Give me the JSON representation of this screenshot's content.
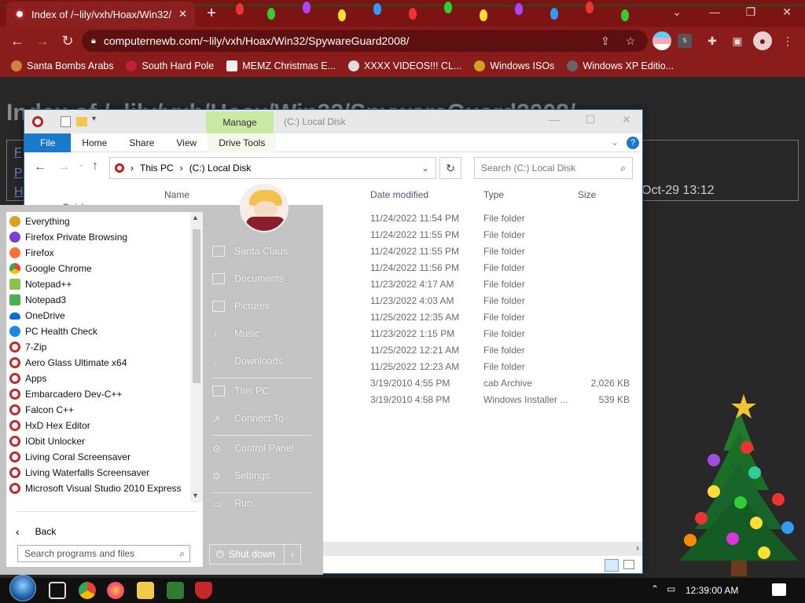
{
  "browser": {
    "tab_title": "Index of /~lily/vxh/Hoax/Win32/",
    "url": "computernewb.com/~lily/vxh/Hoax/Win32/SpywareGuard2008/",
    "bookmarks": [
      "Santa Bombs Arabs",
      "South Hard Pole",
      "MEMZ Christmas E...",
      "XXXX VIDEOS!!! CL...",
      "Windows ISOs",
      "Windows XP Editio..."
    ]
  },
  "page": {
    "heading": "Index of /~lily/vxh/Hoax/Win32/SpywareGuard2008/",
    "date_fragment": "Oct-29 13:12"
  },
  "explorer": {
    "title": "(C:) Local Disk",
    "manage_tab": "Manage",
    "ribbon_tabs": [
      "File",
      "Home",
      "Share",
      "View",
      "Drive Tools"
    ],
    "breadcrumb": [
      "This PC",
      "(C:) Local Disk"
    ],
    "search_placeholder": "Search (C:) Local Disk",
    "nav_item": "Quick access",
    "columns": {
      "name": "Name",
      "date": "Date modified",
      "type": "Type",
      "size": "Size"
    },
    "rows": [
      {
        "date": "11/24/2022 11:54 PM",
        "type": "File folder",
        "size": ""
      },
      {
        "date": "11/24/2022 11:55 PM",
        "type": "File folder",
        "size": ""
      },
      {
        "date": "11/24/2022 11:55 PM",
        "type": "File folder",
        "size": ""
      },
      {
        "date": "11/24/2022 11:56 PM",
        "type": "File folder",
        "size": ""
      },
      {
        "date": "11/23/2022 4:17 AM",
        "type": "File folder",
        "size": ""
      },
      {
        "date": "11/23/2022 4:03 AM",
        "type": "File folder",
        "size": ""
      },
      {
        "date": "11/25/2022 12:35 AM",
        "type": "File folder",
        "size": ""
      },
      {
        "date": "11/23/2022 1:15 PM",
        "type": "File folder",
        "size": ""
      },
      {
        "date": "11/25/2022 12:21 AM",
        "type": "File folder",
        "size": ""
      },
      {
        "date": "11/25/2022 12:23 AM",
        "type": "File folder",
        "size": ""
      },
      {
        "date": "3/19/2010 4:55 PM",
        "type": "cab Archive",
        "size": "2,026 KB"
      },
      {
        "date": "3/19/2010 4:58 PM",
        "type": "Windows Installer ...",
        "size": "539 KB"
      }
    ]
  },
  "start_menu": {
    "apps": [
      {
        "label": "Everything",
        "color": "#e0a020"
      },
      {
        "label": "Firefox Private Browsing",
        "color": "#7b3fd1"
      },
      {
        "label": "Firefox",
        "color": "#ff7139"
      },
      {
        "label": "Google Chrome",
        "color": "#34a853"
      },
      {
        "label": "Notepad++",
        "color": "#8bc34a"
      },
      {
        "label": "Notepad3",
        "color": "#4caf50"
      },
      {
        "label": "OneDrive",
        "color": "#0a6fd6"
      },
      {
        "label": "PC Health Check",
        "color": "#1e88e5"
      },
      {
        "label": "7-Zip",
        "color": "#c62828"
      },
      {
        "label": "Aero Glass Ultimate x64",
        "color": "#c62828"
      },
      {
        "label": "Apps",
        "color": "#c62828"
      },
      {
        "label": "Embarcadero Dev-C++",
        "color": "#c62828"
      },
      {
        "label": "Falcon C++",
        "color": "#c62828"
      },
      {
        "label": "HxD Hex Editor",
        "color": "#c62828"
      },
      {
        "label": "IObit Unlocker",
        "color": "#c62828"
      },
      {
        "label": "Living Coral Screensaver",
        "color": "#c62828"
      },
      {
        "label": "Living Waterfalls Screensaver",
        "color": "#c62828"
      },
      {
        "label": "Microsoft Visual Studio 2010 Express",
        "color": "#c62828"
      }
    ],
    "back_label": "Back",
    "search_placeholder": "Search programs and files",
    "right_items": [
      "Santa Claus",
      "Documents",
      "Pictures",
      "Music",
      "Downloads",
      "This PC",
      "Connect To",
      "Control Panel",
      "Settings",
      "Run..."
    ],
    "shutdown_label": "Shut down"
  },
  "taskbar": {
    "clock": "12:39:00 AM"
  }
}
